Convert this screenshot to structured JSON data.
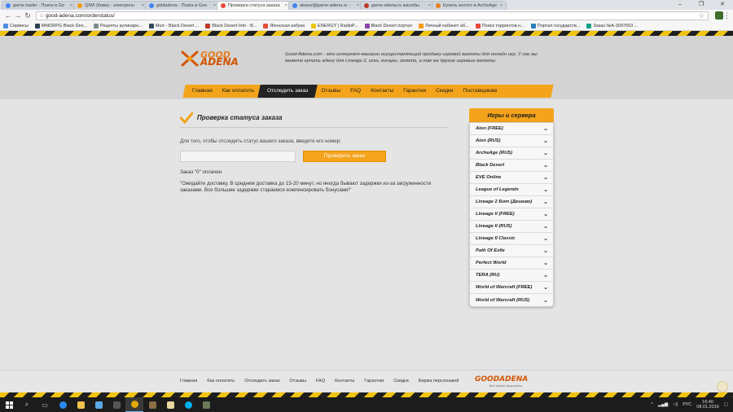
{
  "browser": {
    "tabs": [
      {
        "label": "game trader - Поиск в Go",
        "color": "#4285f4",
        "active": false
      },
      {
        "label": "QIWI (Киви) - электронн",
        "color": "#f39c12",
        "active": false
      },
      {
        "label": "goldadena - Поиск в Goo",
        "color": "#4285f4",
        "active": false
      },
      {
        "label": "Проверка статуса заказа",
        "color": "#e74c3c",
        "active": true
      },
      {
        "label": "aksew@game-adena.ru -",
        "color": "#4285f4",
        "active": false
      },
      {
        "label": "game-adena.ru жалобы",
        "color": "#c0392b",
        "active": false
      },
      {
        "label": "Купить золото в ArcheAge",
        "color": "#e67e22",
        "active": false
      }
    ],
    "url": "good-adena.com/orderstatus/",
    "bookmarks": [
      {
        "label": "Сервисы",
        "color": "#4a90d9"
      },
      {
        "label": "MMORPG Black Des...",
        "color": "#2c3e50"
      },
      {
        "label": "Рецепты кулинарн...",
        "color": "#7f8c8d"
      },
      {
        "label": "Murr - Black Desert ...",
        "color": "#34495e"
      },
      {
        "label": "Black Desert Info - В...",
        "color": "#c0392b"
      },
      {
        "label": "Японская азбука",
        "color": "#e74c3c"
      },
      {
        "label": "ENERGY | RadioP...",
        "color": "#f1c40f"
      },
      {
        "label": "Black Desert портал",
        "color": "#8e44ad"
      },
      {
        "label": "Личный кабинет аб...",
        "color": "#f39c12"
      },
      {
        "label": "Поиск торрентов н...",
        "color": "#e74c3c"
      },
      {
        "label": "Портал государств...",
        "color": "#2980b9"
      },
      {
        "label": "Заказ №A-3097653 ...",
        "color": "#16a085"
      }
    ]
  },
  "site": {
    "logo_line1": "GOOD",
    "logo_line2": "ADENA",
    "tagline": "Good-Adena.com - это интернет-магазин осуществляющий продажу игровой валюты для онлайн игр. У нас вы можете купить адену для Lineage 2, иски, кинары, золото, а так же другие игровые валюты.",
    "nav": [
      {
        "label": "Главная",
        "active": false
      },
      {
        "label": "Как оплатить",
        "active": false
      },
      {
        "label": "Отследить заказ",
        "active": true
      },
      {
        "label": "Отзывы",
        "active": false
      },
      {
        "label": "FAQ",
        "active": false
      },
      {
        "label": "Контакты",
        "active": false
      },
      {
        "label": "Гарантии",
        "active": false
      },
      {
        "label": "Скидки",
        "active": false
      },
      {
        "label": "Поставщикам",
        "active": false
      }
    ]
  },
  "main": {
    "title": "Проверка статуса заказа",
    "instruction": "Для того, чтобы отследить статус вашего заказа, введите его номер:",
    "input_value": "",
    "button_label": "Проверить заказ",
    "status": "Заказ \"0\" оплачен",
    "note": "\"Ожидайте доставку. В среднем доставка до 15-20 минут, но иногда бывают задержки из-за загруженности заказами. Все большие задержки стараемся компенсировать бонусами!\""
  },
  "sidebar": {
    "title": "Игры и сервера",
    "items": [
      "Aion (FREE)",
      "Aion (RUS)",
      "ArcheAge (RUS)",
      "Black Desert",
      "EVE Online",
      "League of Legends",
      "Lineage 2 Бот (Дешево)",
      "Lineage II (FREE)",
      "Lineage II (RUS)",
      "Lineage II Classic",
      "Path Of Exile",
      "Perfect World",
      "TERA (RU)",
      "World of Warcraft (FREE)",
      "World of Warcraft (RUS)"
    ]
  },
  "footer": {
    "links": [
      "Главная",
      "Как оплатить",
      "Отследить заказ",
      "Отзывы",
      "FAQ",
      "Контакты",
      "Гарантии",
      "Скидки",
      "Биржа персонажей"
    ],
    "logo": "GOODADENA",
    "slogan": "Все права защищены"
  },
  "taskbar": {
    "lang": "РУС",
    "time": "16:40",
    "date": "08.01.2016"
  },
  "colors": {
    "accent": "#f3a41a",
    "logo": "#d35400"
  }
}
